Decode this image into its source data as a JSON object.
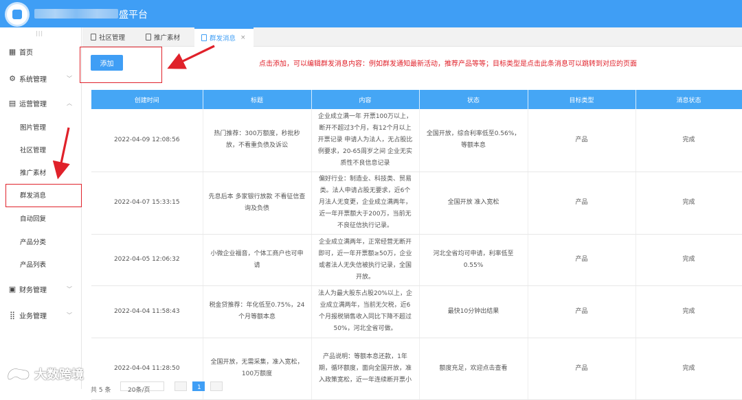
{
  "app": {
    "title": "盛平台"
  },
  "sidebar": {
    "home": "首页",
    "system": "系统管理",
    "operations": "运营管理",
    "sub_items": [
      "图片管理",
      "社区管理",
      "推广素材",
      "群发消息",
      "自动回复",
      "产品分类",
      "产品列表"
    ],
    "finance": "财务管理",
    "business": "业务管理"
  },
  "tabs": [
    {
      "label": "社区管理"
    },
    {
      "label": "推广素材"
    },
    {
      "label": "群发消息",
      "close": "×"
    }
  ],
  "toolbar": {
    "add_label": "添加",
    "note": "点击添加，可以编辑群发消息内容：例如群发通知最新活动，推荐产品等等；目标类型是点击此条消息可以跳转到对应的页面"
  },
  "table": {
    "headers": [
      "创建时间",
      "标题",
      "内容",
      "状态",
      "目标类型",
      "消息状态"
    ],
    "rows": [
      {
        "created": "2022-04-09 12:08:56",
        "title": "热门推荐：300万额度，秒批秒放，不看重负债及诉讼",
        "content": "企业成立满一年 开票100万以上，断开不超过3个月，有12个月以上开票记录 申请人为法人，无占股比例要求，20-65周岁之间 企业无实质性不良信息记录",
        "status": "全国开放，综合利率低至0.56%，等额本息",
        "target": "产品",
        "msg_status": "完成"
      },
      {
        "created": "2022-04-07 15:33:15",
        "title": "先息后本 多家银行放款 不看征信查询及负债",
        "content": "偏好行业：制造业、科技类、贸易类。法人申请占股无要求，近6个月法人无变更，企业成立满两年，近一年开票额大于200万，当前无不良征信执行记录。",
        "status": "全国开放 准入宽松",
        "target": "产品",
        "msg_status": "完成"
      },
      {
        "created": "2022-04-05 12:06:32",
        "title": "小微企业福音，个体工商户也可申请",
        "content": "企业成立满两年，正常经营无断开即可，近一年开票额≥50万，企业或者法人无失信被执行记录，全国开放。",
        "status": "河北全省均可申请，利率低至0.55%",
        "target": "产品",
        "msg_status": "完成"
      },
      {
        "created": "2022-04-04 11:58:43",
        "title": "税金贷推荐：年化低至0.75%，24个月等额本息",
        "content": "法人为最大股东占股20%以上，企业成立满两年，当前无欠税，近6个月报税销售收入同比下降不超过50%，河北全省可做。",
        "status": "最快10分钟出结果",
        "target": "产品",
        "msg_status": "完成"
      },
      {
        "created": "2022-04-04 11:28:50",
        "title": "全国开放，无需采集，准入宽松，100万额度",
        "content": "产品说明：等额本息还款，1年期，循环额度，面向全国开放，准入政策宽松，近一年连续断开票小",
        "status": "额度充足，欢迎点击查看",
        "target": "产品",
        "msg_status": "完成"
      }
    ]
  },
  "pager": {
    "total_label": "共 5 条",
    "page_size": "20条/页",
    "current_page": "1"
  },
  "watermark": "大数跨境",
  "colors": {
    "primary": "#3f9ef5",
    "annotation": "#e0212a"
  }
}
